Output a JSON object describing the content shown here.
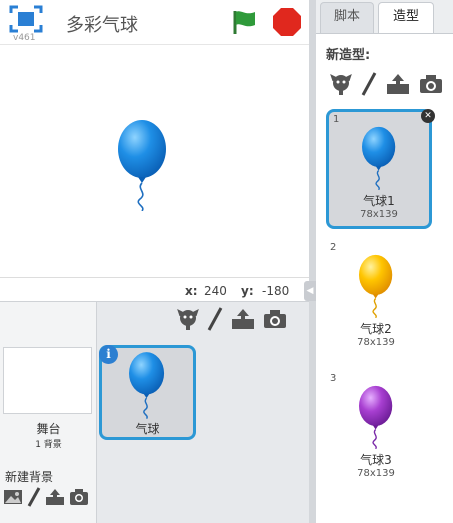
{
  "header": {
    "version": "v461",
    "title": "多彩气球"
  },
  "stage": {
    "x_label": "x:",
    "x_value": "240",
    "y_label": "y:",
    "y_value": "-180"
  },
  "sprite_library": {
    "stage_label": "舞台",
    "stage_backdrop_count": "1 背景",
    "new_backdrop_label": "新建背景",
    "sprites": [
      {
        "name": "气球",
        "color": "#1f8fe6",
        "info": "i"
      }
    ]
  },
  "tabs": [
    {
      "label": "脚本"
    },
    {
      "label": "造型"
    }
  ],
  "costumes": {
    "new_costume_label": "新造型:",
    "items": [
      {
        "number": "1",
        "name": "气球1",
        "size": "78x139",
        "color": "#1f8fe6"
      },
      {
        "number": "2",
        "name": "气球2",
        "size": "78x139",
        "color": "#ffc500"
      },
      {
        "number": "3",
        "name": "气球3",
        "size": "78x139",
        "color": "#a83fd1"
      }
    ]
  },
  "colors": {
    "accent": "#2c98d5",
    "flag": "#2f9a3a",
    "stop": "#e0281e"
  }
}
